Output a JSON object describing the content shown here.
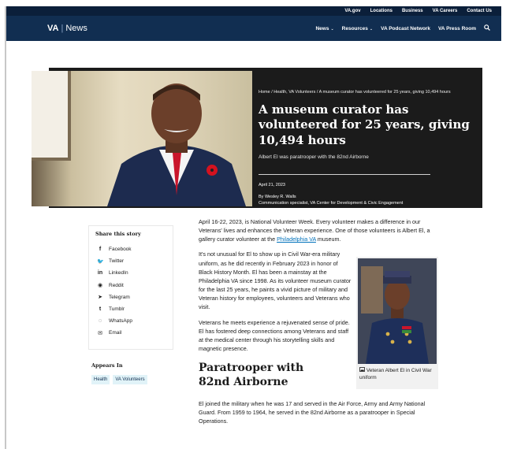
{
  "utility_links": [
    "VA.gov",
    "Locations",
    "Business",
    "VA Careers",
    "Contact Us"
  ],
  "brand": {
    "va": "VA",
    "separator": "|",
    "news": "News"
  },
  "nav": {
    "items": [
      {
        "label": "News",
        "caret": "⌄"
      },
      {
        "label": "Resources",
        "caret": "⌄"
      },
      {
        "label": "VA Podcast Network",
        "caret": ""
      },
      {
        "label": "VA Press Room",
        "caret": ""
      }
    ],
    "search_icon": "search-icon"
  },
  "hero": {
    "breadcrumb": "Home  /  Health, VA Volunteers  /  A museum curator has volunteered for 25 years, giving 10,494 hours",
    "title": "A museum curator has volunteered for 25 years, giving 10,494 hours",
    "subtitle": "Albert El was paratrooper with the 82nd Airborne",
    "date": "April 21, 2023",
    "byline_author": "By Wesley R. Walls",
    "byline_role": "Communication specialist, VA Center for Development & Civic Engagement"
  },
  "share": {
    "title": "Share this story",
    "items": [
      {
        "icon": "f",
        "label": "Facebook"
      },
      {
        "icon": "🐦",
        "label": "Twitter"
      },
      {
        "icon": "in",
        "label": "LinkedIn"
      },
      {
        "icon": "◉",
        "label": "Reddit"
      },
      {
        "icon": "➤",
        "label": "Telegram"
      },
      {
        "icon": "t",
        "label": "Tumblr"
      },
      {
        "icon": "◌",
        "label": "WhatsApp"
      },
      {
        "icon": "✉",
        "label": "Email"
      }
    ]
  },
  "appears_in": {
    "title": "Appears In",
    "tags": [
      "Health",
      "VA Volunteers"
    ]
  },
  "article": {
    "lead_pre": "April 16-22, 2023, is National Volunteer Week. Every volunteer makes a difference in our Veterans' lives and enhances the Veteran experience. One of those volunteers is Albert El, a gallery curator volunteer at the ",
    "lead_link": "Philadelphia VA",
    "lead_post": " museum.",
    "para2": "It's not unusual for El to show up in Civil War-era military uniform, as he did recently in February 2023 in honor of Black History Month. El has been a mainstay at the Philadelphia VA since 1998. As its volunteer museum curator for the last 25 years, he paints a vivid picture of military and Veteran history for employees, volunteers and Veterans who visit.",
    "para3": "Veterans he meets experience a rejuvenated sense of pride. El has fostered deep connections among Veterans and staff at the medical center through his storytelling skills and magnetic presence.",
    "section_title": "Paratrooper with 82nd Airborne",
    "para4": "El joined the military when he was 17 and served in the Air Force, Army and Army National Guard. From 1959 to 1964, he served in the 82nd Airborne as a paratrooper in Special Operations."
  },
  "figure": {
    "icon": "image-icon",
    "caption": "Veteran Albert El in Civil War uniform"
  },
  "colors": {
    "utility_bar": "#0b1f3a",
    "navbar": "#112e51",
    "hero_panel": "#1b1b1b",
    "link": "#0071bb",
    "tag_bg": "#e1f3f8"
  }
}
